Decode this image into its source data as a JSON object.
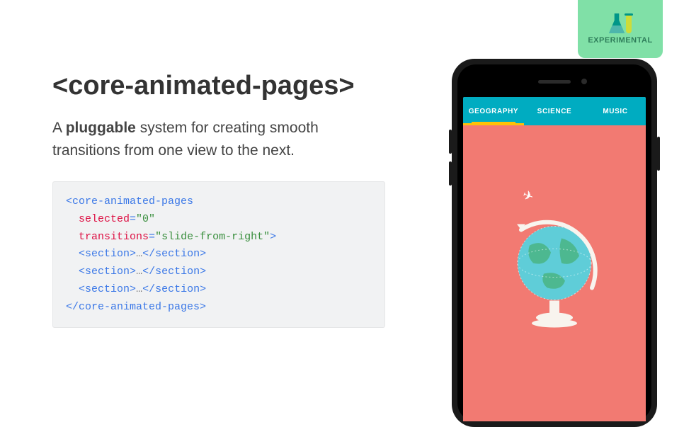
{
  "badge": {
    "label": "EXPERIMENTAL"
  },
  "title": "<core-animated-pages>",
  "description": {
    "prefix": "A ",
    "bold": "pluggable",
    "suffix": " system for creating smooth transitions from one view to the next."
  },
  "code": {
    "open_tag": "core-animated-pages",
    "attr1_name": "selected",
    "attr1_value": "\"0\"",
    "attr2_name": "transitions",
    "attr2_value": "\"slide-from-right\"",
    "section_tag": "section",
    "ellipsis": "…",
    "close_tag": "core-animated-pages"
  },
  "phone": {
    "tabs": [
      {
        "label": "GEOGRAPHY",
        "active": true
      },
      {
        "label": "SCIENCE",
        "active": false
      },
      {
        "label": "MUSIC",
        "active": false
      }
    ]
  },
  "colors": {
    "badge_bg": "#80e0a7",
    "tabbar_bg": "#00acc1",
    "underline": "#ffc107",
    "screen_bg": "#f27a72"
  }
}
